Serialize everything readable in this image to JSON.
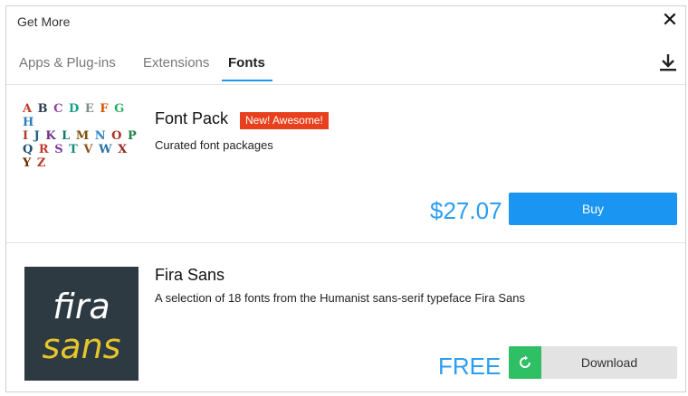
{
  "window": {
    "title": "Get More",
    "close_symbol": "✕"
  },
  "tabs": [
    {
      "label": "Apps & Plug-ins",
      "active": false
    },
    {
      "label": "Extensions",
      "active": false
    },
    {
      "label": "Fonts",
      "active": true
    }
  ],
  "accent_color": "#1a9af0",
  "items": [
    {
      "title": "Font Pack",
      "badge": "New! Awesome!",
      "description": "Curated font packages",
      "price": "$27.07",
      "action_label": "Buy",
      "thumbnail_letters": [
        "A",
        "B",
        "C",
        "D",
        "E",
        "F",
        "G",
        "H",
        "I",
        "J",
        "K",
        "L",
        "M",
        "N",
        "O",
        "P",
        "Q",
        "R",
        "S",
        "T",
        "V",
        "W",
        "X",
        "Y",
        "Z"
      ]
    },
    {
      "title": "Fira Sans",
      "description": "A selection of 18 fonts from the Humanist sans-serif typeface Fira Sans",
      "price": "FREE",
      "action_label": "Download",
      "thumbnail_line1": "fira",
      "thumbnail_line2": "sans"
    }
  ]
}
